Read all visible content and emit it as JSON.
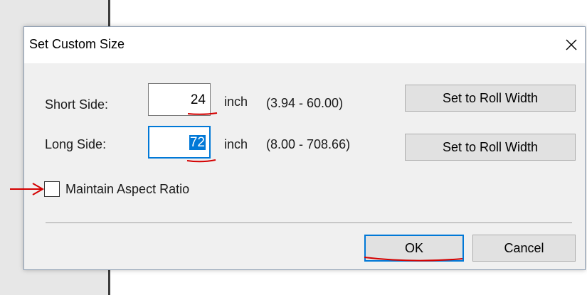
{
  "window": {
    "title": "Set Custom Size",
    "close_glyph": "✕"
  },
  "short_side": {
    "label": "Short Side:",
    "value": "24",
    "unit": "inch",
    "range": "(3.94 - 60.00)",
    "button_label": "Set to Roll Width"
  },
  "long_side": {
    "label": "Long Side:",
    "value": "72",
    "unit": "inch",
    "range": "(8.00 - 708.66)",
    "button_label": "Set to Roll Width"
  },
  "maintain_aspect": {
    "label": "Maintain Aspect Ratio",
    "checked": false
  },
  "buttons": {
    "ok_label": "OK",
    "cancel_label": "Cancel"
  },
  "colors": {
    "accent": "#0078d7",
    "annotation": "#d40000"
  },
  "icons": {
    "close": "close-icon",
    "arrow": "arrow-right-icon"
  }
}
